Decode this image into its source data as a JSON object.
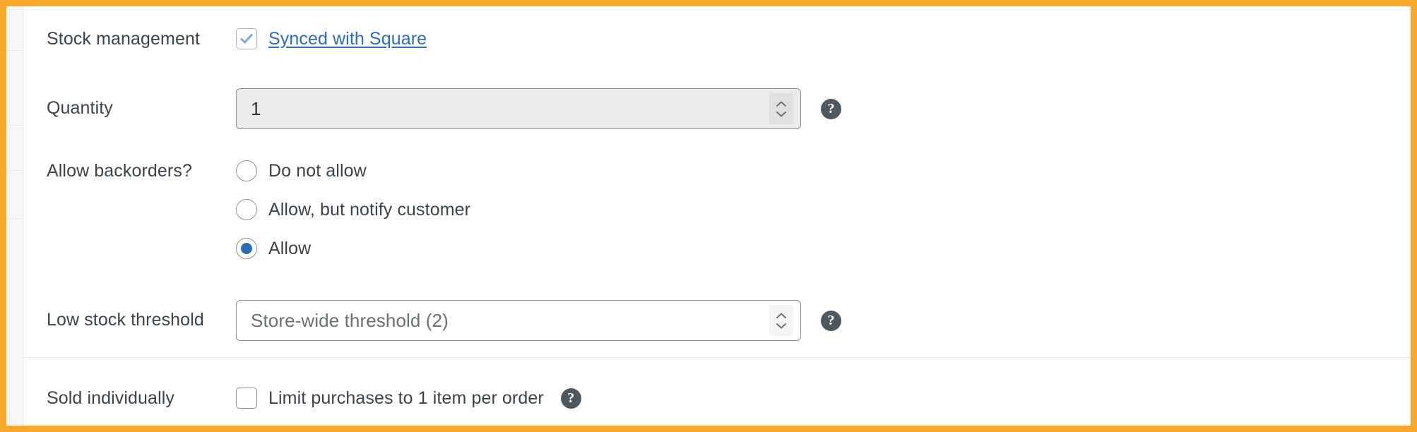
{
  "frame": {
    "accent_border_color": "#f9a72b",
    "panel_background": "#ffffff"
  },
  "rows": {
    "stock_management": {
      "label": "Stock management",
      "checkbox_checked": true,
      "link_label": "Synced with Square",
      "link_color": "#2b6cb8"
    },
    "quantity": {
      "label": "Quantity",
      "value": "1",
      "disabled": true,
      "has_help": true
    },
    "allow_backorders": {
      "label": "Allow backorders?",
      "options": [
        {
          "label": "Do not allow",
          "selected": false
        },
        {
          "label": "Allow, but notify customer",
          "selected": false
        },
        {
          "label": "Allow",
          "selected": true
        }
      ],
      "selected_value": "Allow"
    },
    "low_stock_threshold": {
      "label": "Low stock threshold",
      "placeholder": "Store-wide threshold (2)",
      "value": "",
      "disabled": false,
      "has_help": true
    },
    "sold_individually": {
      "label": "Sold individually",
      "checkbox_checked": false,
      "checkbox_label": "Limit purchases to 1 item per order",
      "has_help": true
    }
  },
  "icons": {
    "help": "?",
    "checkmark": "check-icon",
    "spinner_up": "chevron-up-icon",
    "spinner_down": "chevron-down-icon"
  }
}
